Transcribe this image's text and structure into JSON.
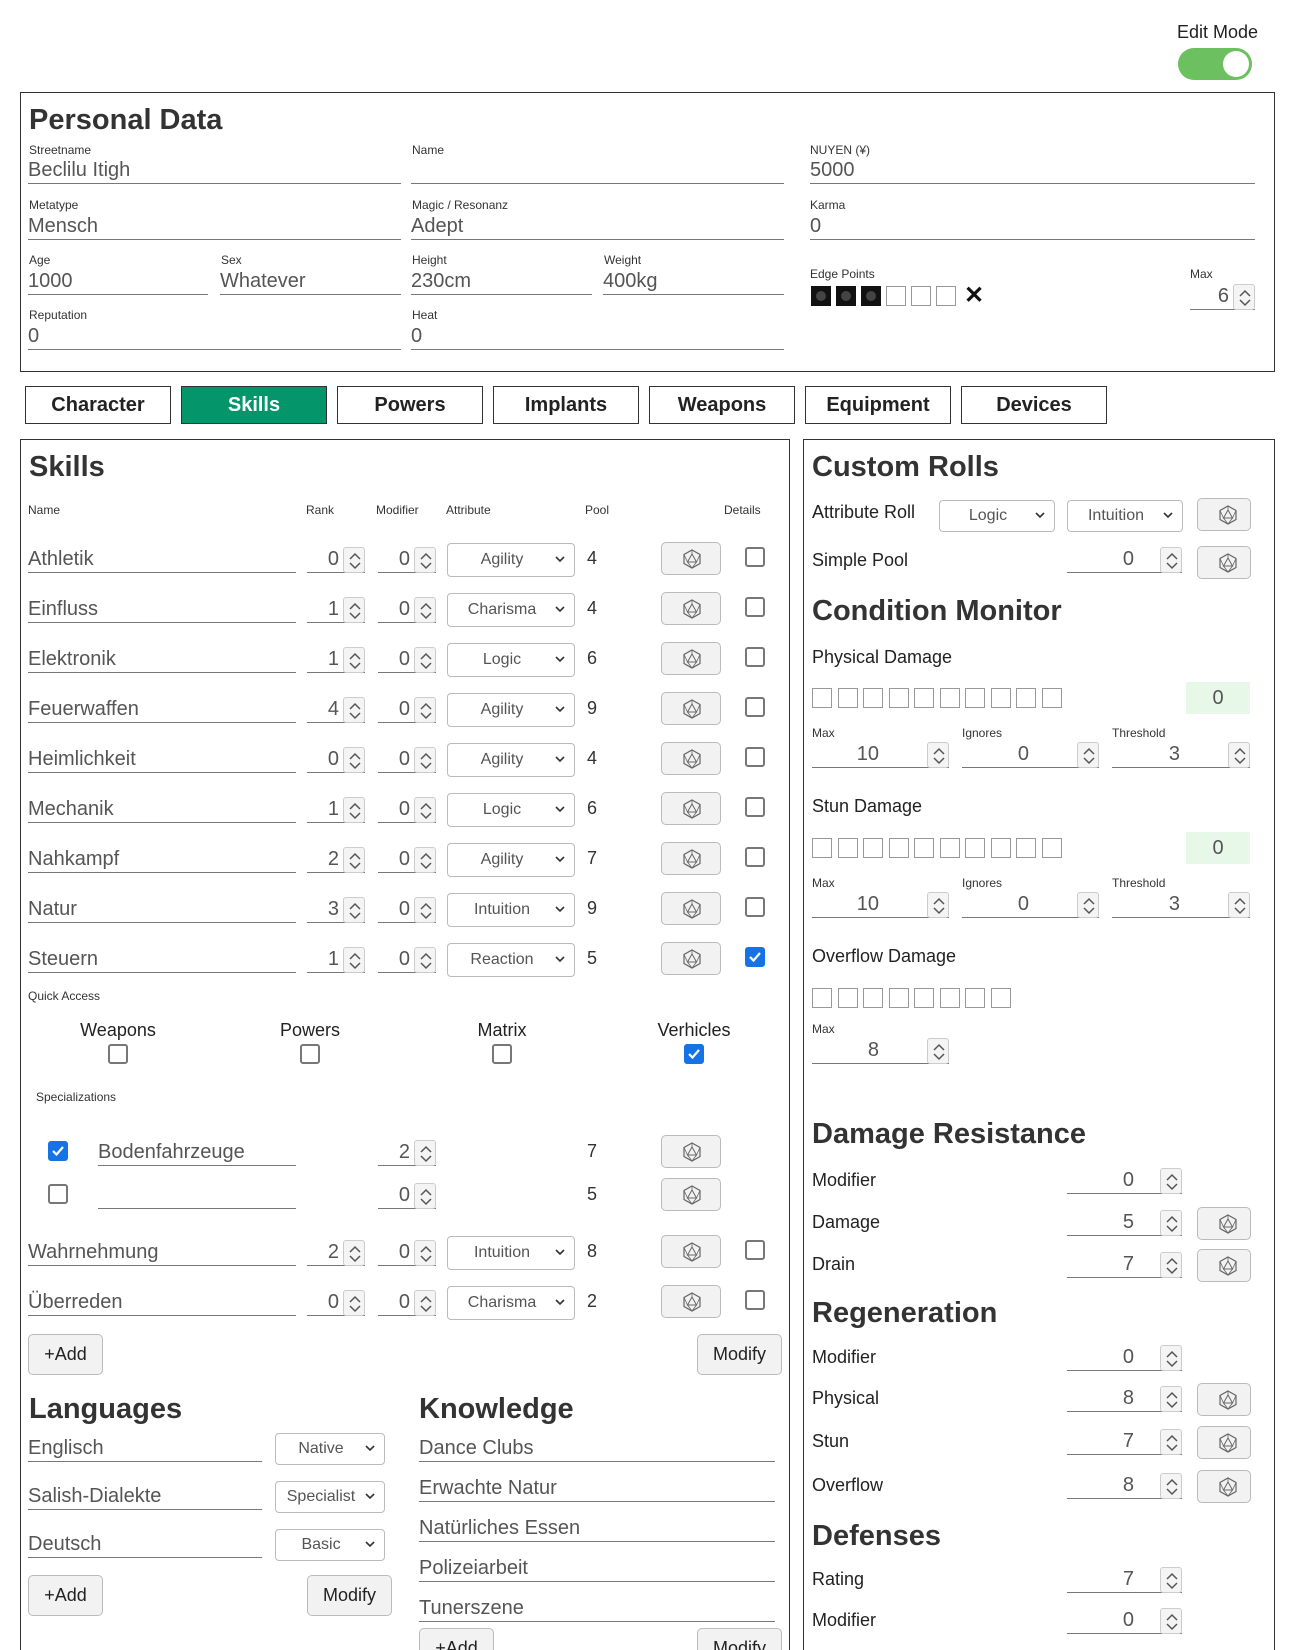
{
  "edit_mode": {
    "label": "Edit Mode",
    "enabled": true
  },
  "personal_data": {
    "title": "Personal Data",
    "streetname": {
      "label": "Streetname",
      "value": "Beclilu Itigh"
    },
    "name": {
      "label": "Name",
      "value": ""
    },
    "nuyen": {
      "label": "NUYEN (¥)",
      "value": "5000"
    },
    "metatype": {
      "label": "Metatype",
      "value": "Mensch"
    },
    "magic": {
      "label": "Magic / Resonanz",
      "value": "Adept"
    },
    "karma": {
      "label": "Karma",
      "value": "0"
    },
    "age": {
      "label": "Age",
      "value": "1000"
    },
    "sex": {
      "label": "Sex",
      "value": "Whatever"
    },
    "height": {
      "label": "Height",
      "value": "230cm"
    },
    "weight": {
      "label": "Weight",
      "value": "400kg"
    },
    "edge_points": {
      "label": "Edge Points",
      "filled": 3,
      "total": 6,
      "clear": "✕"
    },
    "edge_max": {
      "label": "Max",
      "value": "6"
    },
    "reputation": {
      "label": "Reputation",
      "value": "0"
    },
    "heat": {
      "label": "Heat",
      "value": "0"
    }
  },
  "tabs": [
    {
      "label": "Character",
      "active": false
    },
    {
      "label": "Skills",
      "active": true
    },
    {
      "label": "Powers",
      "active": false
    },
    {
      "label": "Implants",
      "active": false
    },
    {
      "label": "Weapons",
      "active": false
    },
    {
      "label": "Equipment",
      "active": false
    },
    {
      "label": "Devices",
      "active": false
    }
  ],
  "skills": {
    "title": "Skills",
    "headers": {
      "name": "Name",
      "rank": "Rank",
      "modifier": "Modifier",
      "attribute": "Attribute",
      "pool": "Pool",
      "details": "Details"
    },
    "rows": [
      {
        "name": "Athletik",
        "rank": "0",
        "modifier": "0",
        "attribute": "Agility",
        "pool": "4",
        "details": false
      },
      {
        "name": "Einfluss",
        "rank": "1",
        "modifier": "0",
        "attribute": "Charisma",
        "pool": "4",
        "details": false
      },
      {
        "name": "Elektronik",
        "rank": "1",
        "modifier": "0",
        "attribute": "Logic",
        "pool": "6",
        "details": false
      },
      {
        "name": "Feuerwaffen",
        "rank": "4",
        "modifier": "0",
        "attribute": "Agility",
        "pool": "9",
        "details": false
      },
      {
        "name": "Heimlichkeit",
        "rank": "0",
        "modifier": "0",
        "attribute": "Agility",
        "pool": "4",
        "details": false
      },
      {
        "name": "Mechanik",
        "rank": "1",
        "modifier": "0",
        "attribute": "Logic",
        "pool": "6",
        "details": false
      },
      {
        "name": "Nahkampf",
        "rank": "2",
        "modifier": "0",
        "attribute": "Agility",
        "pool": "7",
        "details": false
      },
      {
        "name": "Natur",
        "rank": "3",
        "modifier": "0",
        "attribute": "Intuition",
        "pool": "9",
        "details": false
      },
      {
        "name": "Steuern",
        "rank": "1",
        "modifier": "0",
        "attribute": "Reaction",
        "pool": "5",
        "details": true
      }
    ],
    "quick_access": {
      "label": "Quick Access",
      "items": [
        {
          "label": "Weapons",
          "checked": false
        },
        {
          "label": "Powers",
          "checked": false
        },
        {
          "label": "Matrix",
          "checked": false
        },
        {
          "label": "Verhicles",
          "checked": true
        }
      ]
    },
    "specializations": {
      "label": "Specializations",
      "rows": [
        {
          "checked": true,
          "name": "Bodenfahrzeuge",
          "modifier": "2",
          "pool": "7"
        },
        {
          "checked": false,
          "name": "",
          "modifier": "0",
          "pool": "5"
        }
      ]
    },
    "rows_after": [
      {
        "name": "Wahrnehmung",
        "rank": "2",
        "modifier": "0",
        "attribute": "Intuition",
        "pool": "8",
        "details": false
      },
      {
        "name": "Überreden",
        "rank": "0",
        "modifier": "0",
        "attribute": "Charisma",
        "pool": "2",
        "details": false
      }
    ],
    "add_label": "+Add",
    "modify_label": "Modify"
  },
  "languages": {
    "title": "Languages",
    "items": [
      {
        "name": "Englisch",
        "level": "Native"
      },
      {
        "name": "Salish-Dialekte",
        "level": "Specialist"
      },
      {
        "name": "Deutsch",
        "level": "Basic"
      }
    ],
    "add_label": "+Add",
    "modify_label": "Modify"
  },
  "knowledge": {
    "title": "Knowledge",
    "items": [
      "Dance Clubs",
      "Erwachte Natur",
      "Natürliches Essen",
      "Polizeiarbeit",
      "Tunerszene"
    ],
    "add_label": "+Add",
    "modify_label": "Modify"
  },
  "custom_rolls": {
    "title": "Custom Rolls",
    "attribute_roll": {
      "label": "Attribute Roll",
      "first": "Logic",
      "second": "Intuition"
    },
    "simple_pool": {
      "label": "Simple Pool",
      "value": "0"
    }
  },
  "condition_monitor": {
    "title": "Condition Monitor",
    "physical": {
      "label": "Physical Damage",
      "boxes": 10,
      "current": "0",
      "max_label": "Max",
      "max": "10",
      "ignores_label": "Ignores",
      "ignores": "0",
      "threshold_label": "Threshold",
      "threshold": "3"
    },
    "stun": {
      "label": "Stun Damage",
      "boxes": 10,
      "current": "0",
      "max_label": "Max",
      "max": "10",
      "ignores_label": "Ignores",
      "ignores": "0",
      "threshold_label": "Threshold",
      "threshold": "3"
    },
    "overflow": {
      "label": "Overflow Damage",
      "boxes": 8,
      "max_label": "Max",
      "max": "8"
    }
  },
  "damage_resistance": {
    "title": "Damage Resistance",
    "rows": [
      {
        "label": "Modifier",
        "value": "0",
        "dice": false
      },
      {
        "label": "Damage",
        "value": "5",
        "dice": true
      },
      {
        "label": "Drain",
        "value": "7",
        "dice": true
      }
    ]
  },
  "regeneration": {
    "title": "Regeneration",
    "rows": [
      {
        "label": "Modifier",
        "value": "0",
        "dice": false
      },
      {
        "label": "Physical",
        "value": "8",
        "dice": true
      },
      {
        "label": "Stun",
        "value": "7",
        "dice": true
      },
      {
        "label": "Overflow",
        "value": "8",
        "dice": true
      }
    ]
  },
  "defenses": {
    "title": "Defenses",
    "rows": [
      {
        "label": "Rating",
        "value": "7",
        "dice": false
      },
      {
        "label": "Modifier",
        "value": "0",
        "dice": false
      }
    ]
  }
}
